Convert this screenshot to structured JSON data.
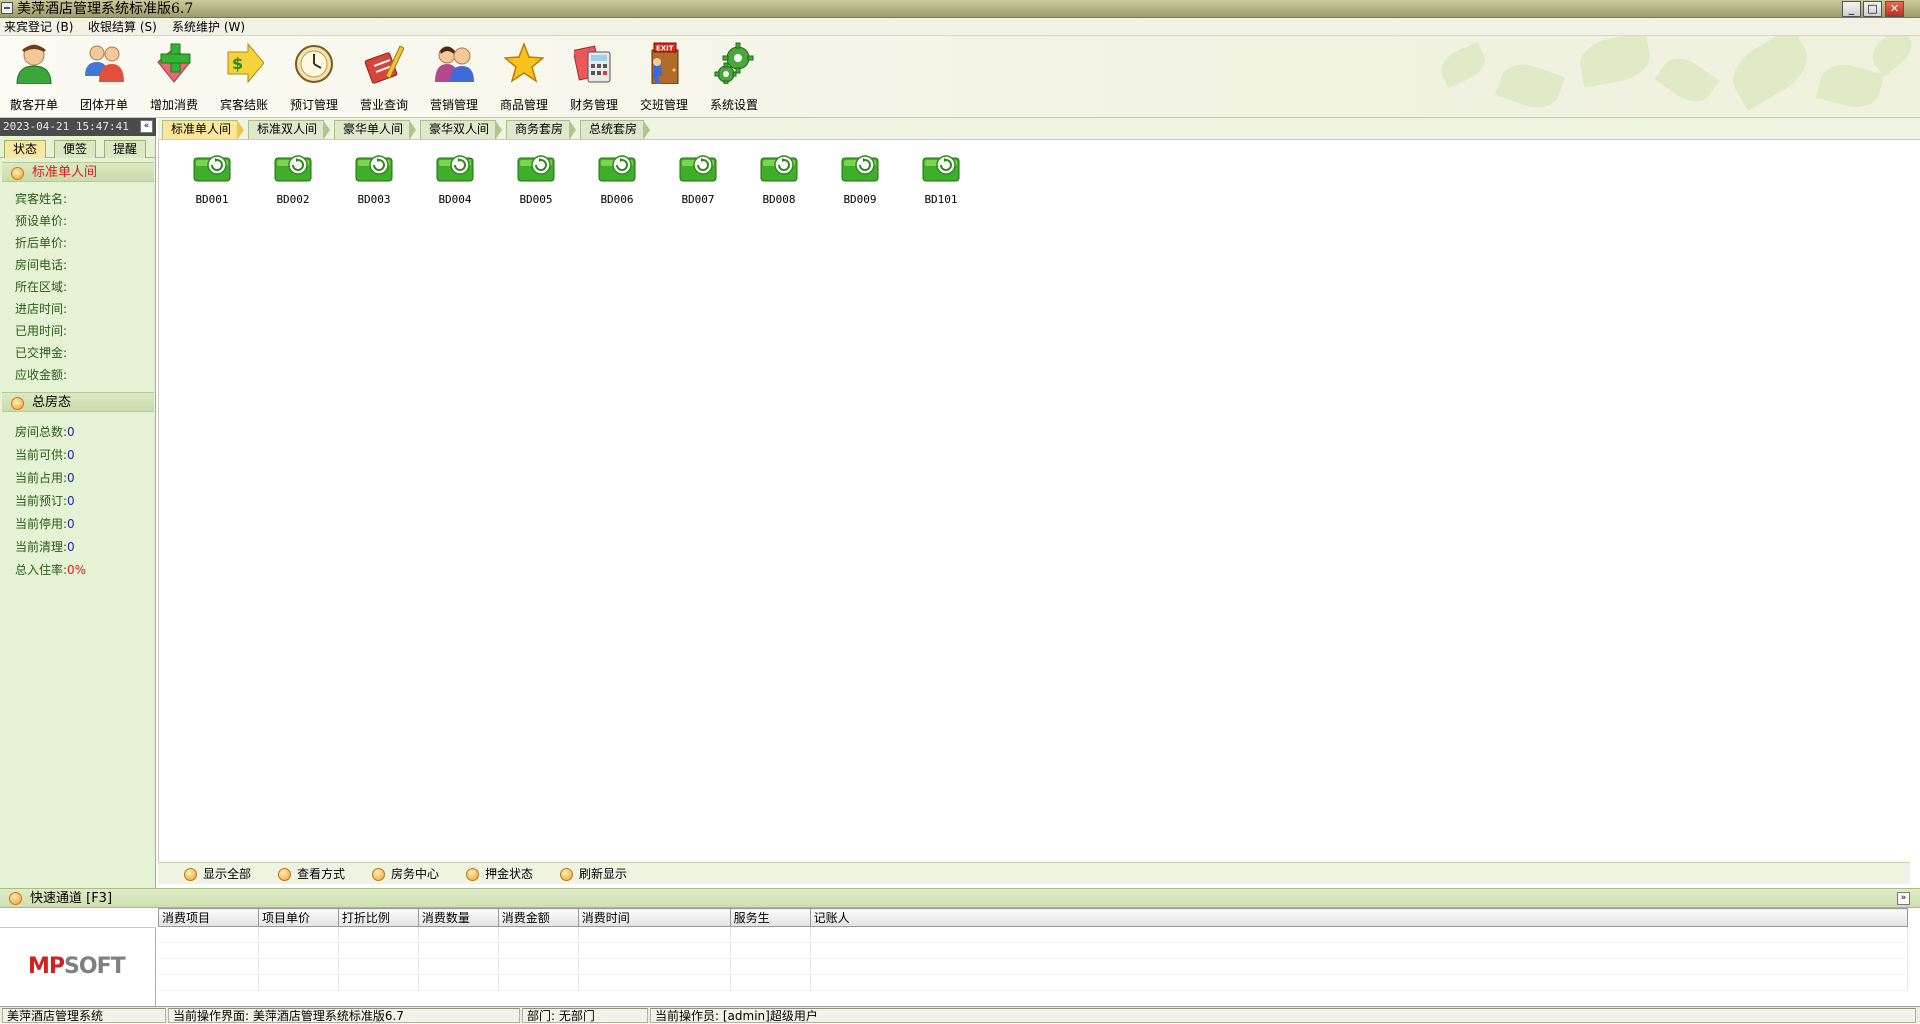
{
  "window": {
    "title": "美萍酒店管理系统标准版6.7",
    "buttons": {
      "minimize": "_",
      "maximize": "□",
      "close": "✕"
    }
  },
  "menu": [
    {
      "label": "来宾登记 (B)"
    },
    {
      "label": "收银结算 (S)"
    },
    {
      "label": "系统维护 (W)"
    }
  ],
  "toolbar": [
    {
      "label": "散客开单",
      "icon": "single-guest-icon"
    },
    {
      "label": "团体开单",
      "icon": "group-guests-icon"
    },
    {
      "label": "增加消费",
      "icon": "add-consumption-icon"
    },
    {
      "label": "宾客结账",
      "icon": "checkout-icon"
    },
    {
      "label": "预订管理",
      "icon": "reservation-clock-icon"
    },
    {
      "label": "营业查询",
      "icon": "business-query-icon"
    },
    {
      "label": "营销管理",
      "icon": "marketing-icon"
    },
    {
      "label": "商品管理",
      "icon": "star-icon"
    },
    {
      "label": "财务管理",
      "icon": "finance-icon"
    },
    {
      "label": "交班管理",
      "icon": "exit-door-icon",
      "sign": "EXIT"
    },
    {
      "label": "系统设置",
      "icon": "gear-icon"
    }
  ],
  "left_panel": {
    "datetime": "2023-04-21 15:47:41",
    "collapse": "«",
    "tabs": [
      {
        "label": "状态",
        "active": true
      },
      {
        "label": "便签",
        "active": false
      },
      {
        "label": "提醒",
        "active": false
      }
    ],
    "room_section": {
      "title": "标准单人间",
      "fields": [
        {
          "label": "宾客姓名:",
          "value": ""
        },
        {
          "label": "预设单价:",
          "value": ""
        },
        {
          "label": "折后单价:",
          "value": ""
        },
        {
          "label": "房间电话:",
          "value": ""
        },
        {
          "label": "所在区域:",
          "value": ""
        },
        {
          "label": "进店时间:",
          "value": ""
        },
        {
          "label": "已用时间:",
          "value": ""
        },
        {
          "label": "已交押金:",
          "value": ""
        },
        {
          "label": "应收金额:",
          "value": ""
        }
      ]
    },
    "status_section": {
      "title": "总房态",
      "fields": [
        {
          "label": "房间总数:",
          "value": "0"
        },
        {
          "label": "当前可供:",
          "value": "0"
        },
        {
          "label": "当前占用:",
          "value": "0"
        },
        {
          "label": "当前预订:",
          "value": "0"
        },
        {
          "label": "当前停用:",
          "value": "0"
        },
        {
          "label": "当前清理:",
          "value": "0"
        },
        {
          "label": "总入住率:",
          "value": "0%"
        }
      ]
    }
  },
  "room_tabs": [
    {
      "label": "标准单人间",
      "active": true
    },
    {
      "label": "标准双人间",
      "active": false
    },
    {
      "label": "豪华单人间",
      "active": false
    },
    {
      "label": "豪华双人间",
      "active": false
    },
    {
      "label": "商务套房",
      "active": false
    },
    {
      "label": "总统套房",
      "active": false
    }
  ],
  "rooms": [
    {
      "name": "BD001"
    },
    {
      "name": "BD002"
    },
    {
      "name": "BD003"
    },
    {
      "name": "BD004"
    },
    {
      "name": "BD005"
    },
    {
      "name": "BD006"
    },
    {
      "name": "BD007"
    },
    {
      "name": "BD008"
    },
    {
      "name": "BD009"
    },
    {
      "name": "BD101"
    }
  ],
  "actions": [
    {
      "label": "显示全部"
    },
    {
      "label": "查看方式"
    },
    {
      "label": "房务中心"
    },
    {
      "label": "押金状态"
    },
    {
      "label": "刷新显示"
    }
  ],
  "quick_channel": {
    "title": "快速通道 [F3]",
    "toggle": "»"
  },
  "logo": {
    "m": "MP",
    "s": "SOFT"
  },
  "consumption_table": {
    "columns": [
      "消费项目",
      "项目单价",
      "打折比例",
      "消费数量",
      "消费金额",
      "消费时间",
      "服务生",
      "记账人"
    ]
  },
  "statusbar": {
    "app": "美萍酒店管理系统",
    "current_ui": "当前操作界面: 美萍酒店管理系统标准版6.7",
    "department": "部门: 无部门",
    "operator": "当前操作员: [admin]超级用户"
  },
  "colors": {
    "panel_green": "#e6f2d4",
    "active_tab": "#fbe69c",
    "value_blue": "#1a2ab0",
    "value_red": "#e01a1a"
  }
}
